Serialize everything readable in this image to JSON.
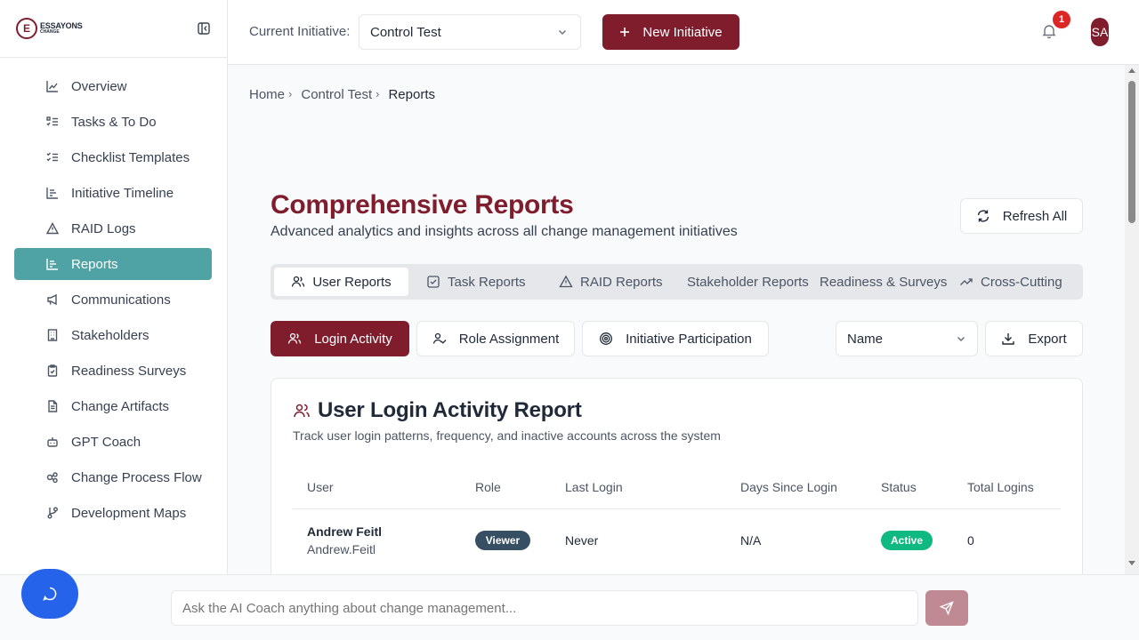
{
  "logo": {
    "letter": "E",
    "line1": "ESSAYONS",
    "line2": "CHANGE"
  },
  "sidebar": {
    "items": [
      {
        "label": "Overview",
        "icon": "line-chart-icon"
      },
      {
        "label": "Tasks & To Do",
        "icon": "list-todo-icon"
      },
      {
        "label": "Checklist Templates",
        "icon": "list-checks-icon"
      },
      {
        "label": "Initiative Timeline",
        "icon": "timeline-icon"
      },
      {
        "label": "RAID Logs",
        "icon": "warning-triangle-icon"
      },
      {
        "label": "Reports",
        "icon": "bar-chart-icon",
        "active": true
      },
      {
        "label": "Communications",
        "icon": "megaphone-icon"
      },
      {
        "label": "Stakeholders",
        "icon": "building-icon"
      },
      {
        "label": "Readiness Surveys",
        "icon": "clipboard-check-icon"
      },
      {
        "label": "Change Artifacts",
        "icon": "file-text-icon"
      },
      {
        "label": "GPT Coach",
        "icon": "bot-icon"
      },
      {
        "label": "Change Process Flow",
        "icon": "flow-icon"
      },
      {
        "label": "Development Maps",
        "icon": "git-branch-icon"
      }
    ]
  },
  "topbar": {
    "initiative_label": "Current Initiative:",
    "initiative_value": "Control Test",
    "new_button": "New Initiative",
    "notification_count": "1",
    "avatar_initials": "SA"
  },
  "breadcrumb": {
    "home": "Home",
    "initiative": "Control Test",
    "current": "Reports"
  },
  "page": {
    "title": "Comprehensive Reports",
    "subtitle": "Advanced analytics and insights across all change management initiatives",
    "refresh_label": "Refresh All"
  },
  "tabs": [
    {
      "label": "User Reports",
      "active": true
    },
    {
      "label": "Task Reports"
    },
    {
      "label": "RAID Reports"
    },
    {
      "label": "Stakeholder Reports"
    },
    {
      "label": "Readiness & Surveys"
    },
    {
      "label": "Cross-Cutting"
    }
  ],
  "subtabs": [
    {
      "label": "Login Activity",
      "active": true
    },
    {
      "label": "Role Assignment"
    },
    {
      "label": "Initiative Participation"
    }
  ],
  "sort": {
    "value": "Name"
  },
  "export_label": "Export",
  "report": {
    "title": "User Login Activity Report",
    "subtitle": "Track user login patterns, frequency, and inactive accounts across the system",
    "columns": [
      "User",
      "Role",
      "Last Login",
      "Days Since Login",
      "Status",
      "Total Logins"
    ],
    "rows": [
      {
        "name": "Andrew Feitl",
        "username": "Andrew.Feitl",
        "role": "Viewer",
        "last_login": "Never",
        "days_since": "N/A",
        "status": "Active",
        "total_logins": "0"
      }
    ]
  },
  "chat": {
    "placeholder": "Ask the AI Coach anything about change management..."
  },
  "colors": {
    "brand": "#7f1d2d",
    "active_nav": "#4fa3a5",
    "fab": "#2563eb",
    "status_active": "#10b981",
    "role_pill": "#374f63"
  }
}
